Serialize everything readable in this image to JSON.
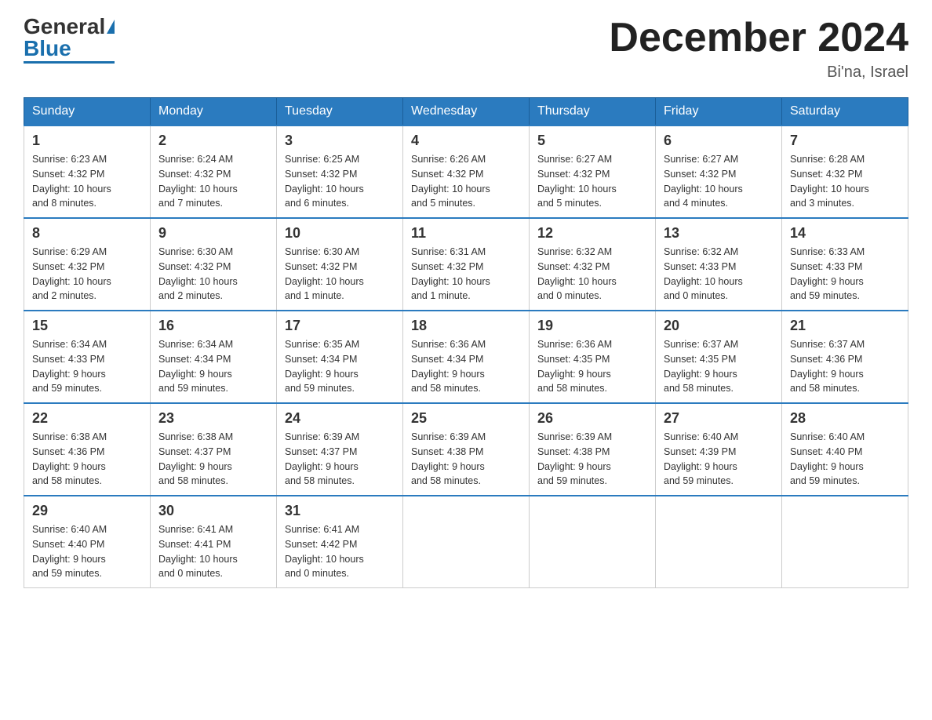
{
  "logo": {
    "general": "General",
    "blue": "Blue"
  },
  "title": {
    "month": "December 2024",
    "location": "Bi'na, Israel"
  },
  "days_of_week": [
    "Sunday",
    "Monday",
    "Tuesday",
    "Wednesday",
    "Thursday",
    "Friday",
    "Saturday"
  ],
  "weeks": [
    [
      {
        "day": "1",
        "sunrise": "6:23 AM",
        "sunset": "4:32 PM",
        "daylight": "10 hours and 8 minutes."
      },
      {
        "day": "2",
        "sunrise": "6:24 AM",
        "sunset": "4:32 PM",
        "daylight": "10 hours and 7 minutes."
      },
      {
        "day": "3",
        "sunrise": "6:25 AM",
        "sunset": "4:32 PM",
        "daylight": "10 hours and 6 minutes."
      },
      {
        "day": "4",
        "sunrise": "6:26 AM",
        "sunset": "4:32 PM",
        "daylight": "10 hours and 5 minutes."
      },
      {
        "day": "5",
        "sunrise": "6:27 AM",
        "sunset": "4:32 PM",
        "daylight": "10 hours and 5 minutes."
      },
      {
        "day": "6",
        "sunrise": "6:27 AM",
        "sunset": "4:32 PM",
        "daylight": "10 hours and 4 minutes."
      },
      {
        "day": "7",
        "sunrise": "6:28 AM",
        "sunset": "4:32 PM",
        "daylight": "10 hours and 3 minutes."
      }
    ],
    [
      {
        "day": "8",
        "sunrise": "6:29 AM",
        "sunset": "4:32 PM",
        "daylight": "10 hours and 2 minutes."
      },
      {
        "day": "9",
        "sunrise": "6:30 AM",
        "sunset": "4:32 PM",
        "daylight": "10 hours and 2 minutes."
      },
      {
        "day": "10",
        "sunrise": "6:30 AM",
        "sunset": "4:32 PM",
        "daylight": "10 hours and 1 minute."
      },
      {
        "day": "11",
        "sunrise": "6:31 AM",
        "sunset": "4:32 PM",
        "daylight": "10 hours and 1 minute."
      },
      {
        "day": "12",
        "sunrise": "6:32 AM",
        "sunset": "4:32 PM",
        "daylight": "10 hours and 0 minutes."
      },
      {
        "day": "13",
        "sunrise": "6:32 AM",
        "sunset": "4:33 PM",
        "daylight": "10 hours and 0 minutes."
      },
      {
        "day": "14",
        "sunrise": "6:33 AM",
        "sunset": "4:33 PM",
        "daylight": "9 hours and 59 minutes."
      }
    ],
    [
      {
        "day": "15",
        "sunrise": "6:34 AM",
        "sunset": "4:33 PM",
        "daylight": "9 hours and 59 minutes."
      },
      {
        "day": "16",
        "sunrise": "6:34 AM",
        "sunset": "4:34 PM",
        "daylight": "9 hours and 59 minutes."
      },
      {
        "day": "17",
        "sunrise": "6:35 AM",
        "sunset": "4:34 PM",
        "daylight": "9 hours and 59 minutes."
      },
      {
        "day": "18",
        "sunrise": "6:36 AM",
        "sunset": "4:34 PM",
        "daylight": "9 hours and 58 minutes."
      },
      {
        "day": "19",
        "sunrise": "6:36 AM",
        "sunset": "4:35 PM",
        "daylight": "9 hours and 58 minutes."
      },
      {
        "day": "20",
        "sunrise": "6:37 AM",
        "sunset": "4:35 PM",
        "daylight": "9 hours and 58 minutes."
      },
      {
        "day": "21",
        "sunrise": "6:37 AM",
        "sunset": "4:36 PM",
        "daylight": "9 hours and 58 minutes."
      }
    ],
    [
      {
        "day": "22",
        "sunrise": "6:38 AM",
        "sunset": "4:36 PM",
        "daylight": "9 hours and 58 minutes."
      },
      {
        "day": "23",
        "sunrise": "6:38 AM",
        "sunset": "4:37 PM",
        "daylight": "9 hours and 58 minutes."
      },
      {
        "day": "24",
        "sunrise": "6:39 AM",
        "sunset": "4:37 PM",
        "daylight": "9 hours and 58 minutes."
      },
      {
        "day": "25",
        "sunrise": "6:39 AM",
        "sunset": "4:38 PM",
        "daylight": "9 hours and 58 minutes."
      },
      {
        "day": "26",
        "sunrise": "6:39 AM",
        "sunset": "4:38 PM",
        "daylight": "9 hours and 59 minutes."
      },
      {
        "day": "27",
        "sunrise": "6:40 AM",
        "sunset": "4:39 PM",
        "daylight": "9 hours and 59 minutes."
      },
      {
        "day": "28",
        "sunrise": "6:40 AM",
        "sunset": "4:40 PM",
        "daylight": "9 hours and 59 minutes."
      }
    ],
    [
      {
        "day": "29",
        "sunrise": "6:40 AM",
        "sunset": "4:40 PM",
        "daylight": "9 hours and 59 minutes."
      },
      {
        "day": "30",
        "sunrise": "6:41 AM",
        "sunset": "4:41 PM",
        "daylight": "10 hours and 0 minutes."
      },
      {
        "day": "31",
        "sunrise": "6:41 AM",
        "sunset": "4:42 PM",
        "daylight": "10 hours and 0 minutes."
      },
      null,
      null,
      null,
      null
    ]
  ],
  "labels": {
    "sunrise_prefix": "Sunrise: ",
    "sunset_prefix": "Sunset: ",
    "daylight_prefix": "Daylight: "
  }
}
